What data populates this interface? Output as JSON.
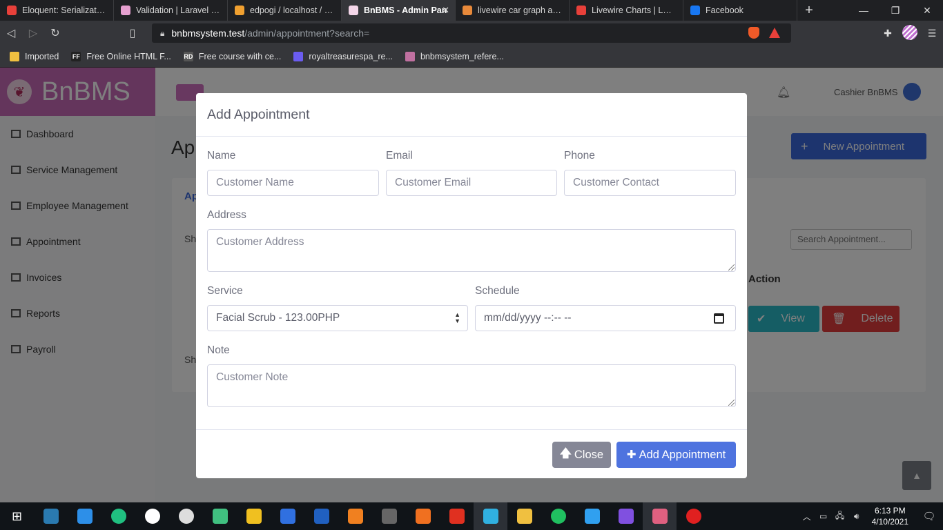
{
  "browser": {
    "tabs": [
      {
        "title": "Eloquent: Serialization -",
        "color": "#e8403a",
        "active": false
      },
      {
        "title": "Validation | Laravel Livev",
        "color": "#e6a0d0",
        "active": false
      },
      {
        "title": "edpogi / localhost / bnb",
        "color": "#f0a030",
        "active": false
      },
      {
        "title": "BnBMS - Admin Pan",
        "color": "#f4d6e9",
        "active": true
      },
      {
        "title": "livewire car graph at Du",
        "color": "#e8893a",
        "active": false
      },
      {
        "title": "Livewire Charts | Laravel",
        "color": "#e8403a",
        "active": false
      },
      {
        "title": "Facebook",
        "color": "#1877f2",
        "active": false
      }
    ],
    "tab_close": "✕",
    "new_tab": "+",
    "url_host": "bnbmsystem.test",
    "url_path": "/admin/appointment?search=",
    "bookmarks": [
      {
        "label": "Imported",
        "icon_text": "",
        "color": "#f0c040"
      },
      {
        "label": "Free Online HTML F...",
        "icon_text": "FF",
        "color": "#222"
      },
      {
        "label": "Free course with ce...",
        "icon_text": "RD",
        "color": "#555"
      },
      {
        "label": "royaltreasurespa_re...",
        "icon_text": "",
        "color": "#6b5cf0"
      },
      {
        "label": "bnbmsystem_refere...",
        "icon_text": "",
        "color": "#c070a0"
      }
    ]
  },
  "app": {
    "brand": "BnBMS",
    "sidebar": [
      "Dashboard",
      "Service Management",
      "Employee Management",
      "Appointment",
      "Invoices",
      "Reports",
      "Payroll"
    ],
    "user_name": "Cashier BnBMS",
    "page_title_partial": "Ap",
    "new_appointment": "New Appointment",
    "card_heading_partial": "Ap",
    "card_show_partial": "Sh",
    "card_show2_partial": "Sh",
    "search_placeholder": "Search Appointment...",
    "action_col": "Action",
    "view_btn": "View",
    "delete_btn": "Delete"
  },
  "modal": {
    "title": "Add Appointment",
    "name_label": "Name",
    "name_placeholder": "Customer Name",
    "email_label": "Email",
    "email_placeholder": "Customer Email",
    "phone_label": "Phone",
    "phone_placeholder": "Customer Contact",
    "address_label": "Address",
    "address_placeholder": "Customer Address",
    "service_label": "Service",
    "service_selected": "Facial Scrub - 123.00PHP",
    "schedule_label": "Schedule",
    "schedule_placeholder": "mm/dd/yyyy --:-- --",
    "note_label": "Note",
    "note_placeholder": "Customer Note",
    "close_btn": "Close",
    "add_btn": "Add Appointment"
  },
  "taskbar": {
    "time": "6:13 PM",
    "date": "4/10/2021",
    "apps": [
      "#2a7ab0",
      "#2d8fe8",
      "#20c080",
      "#ffffff",
      "#dddddd",
      "#40c080",
      "#f0c020",
      "#3070e0",
      "#2060c0",
      "#f08020",
      "#666666",
      "#f07020",
      "#e03020",
      "#30b0e0",
      "#f0c040",
      "#20c060",
      "#30a0f0",
      "#8050e0",
      "#e06080",
      "#e02020"
    ]
  }
}
